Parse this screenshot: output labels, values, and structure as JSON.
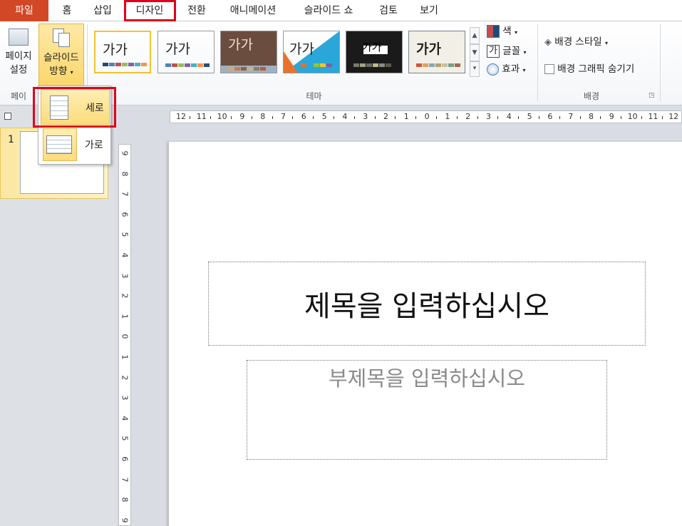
{
  "tabs": {
    "file": "파일",
    "home": "홈",
    "insert": "삽입",
    "design": "디자인",
    "transitions": "전환",
    "animations": "애니메이션",
    "slideshow": "슬라이드 쇼",
    "review": "검토",
    "view": "보기"
  },
  "ribbon": {
    "page_setup": {
      "line1": "페이지",
      "line2": "설정"
    },
    "orientation": {
      "line1": "슬라이드",
      "line2": "방향"
    },
    "page_setup_group_label": "페이",
    "themes_group_label": "테마",
    "themes": [
      {
        "text": "가가",
        "bg": "#ffffff",
        "fg": "#000000",
        "selected": true
      },
      {
        "text": "가가",
        "bg": "#ffffff",
        "fg": "#000000",
        "selected": false
      },
      {
        "text": "가가",
        "bg": "#6b4d3f",
        "fg": "#f0e0c8",
        "selected": false
      },
      {
        "text": "가가",
        "bg": "#ffffff",
        "fg": "#000000",
        "selected": false
      },
      {
        "text": "가가",
        "bg": "#1a1a1a",
        "fg": "#000000",
        "selected": false
      },
      {
        "text": "가가",
        "bg": "#f2efe6",
        "fg": "#000000",
        "selected": false
      }
    ],
    "colors_label": "색",
    "fonts_label": "글꼴",
    "fonts_glyph": "가",
    "effects_label": "효과",
    "bg_styles_label": "배경 스타일",
    "hide_bg_graphics_label": "배경 그래픽 숨기기",
    "background_group_label": "배경"
  },
  "orientation_menu": {
    "portrait": "세로",
    "landscape": "가로"
  },
  "thumbnails": {
    "slide_number": "1"
  },
  "hruler_labels": [
    "12",
    "11",
    "10",
    "9",
    "8",
    "7",
    "6",
    "5",
    "4",
    "3",
    "2",
    "1",
    "0",
    "1",
    "2",
    "3",
    "4",
    "5",
    "6",
    "7",
    "8",
    "9",
    "10",
    "11",
    "12"
  ],
  "vruler_labels": [
    "9",
    "8",
    "7",
    "6",
    "5",
    "4",
    "3",
    "2",
    "1",
    "0",
    "1",
    "2",
    "3",
    "4",
    "5",
    "6",
    "7",
    "8",
    "9"
  ],
  "slide": {
    "title_placeholder": "제목을 입력하십시오",
    "subtitle_placeholder": "부제목을 입력하십시오"
  },
  "colors": {
    "file_tab": "#d24726",
    "highlight_box": "#e0001b",
    "selected_bg": "#fde48a"
  }
}
